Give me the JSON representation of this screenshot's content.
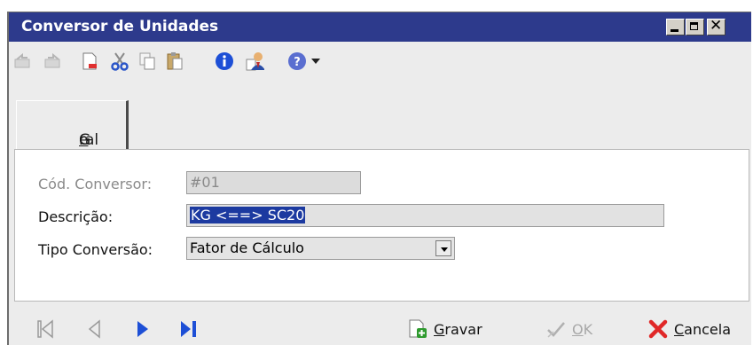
{
  "window": {
    "title": "Conversor de Unidades",
    "controls": {
      "minimize": "minimize",
      "maximize": "maximize",
      "close": "close"
    }
  },
  "toolbar": {
    "items": [
      {
        "icon": "undo-icon",
        "enabled": false
      },
      {
        "icon": "redo-icon",
        "enabled": false
      },
      {
        "icon": "new-document-icon",
        "enabled": true
      },
      {
        "icon": "cut-icon",
        "enabled": true
      },
      {
        "icon": "copy-icon",
        "enabled": true
      },
      {
        "icon": "paste-icon",
        "enabled": true
      },
      {
        "icon": "info-icon",
        "enabled": true
      },
      {
        "icon": "user-document-icon",
        "enabled": true
      },
      {
        "icon": "help-icon",
        "enabled": true
      }
    ]
  },
  "tabs": [
    {
      "label_pre": "G",
      "label_u": "e",
      "label_post": "ral",
      "selected": true
    }
  ],
  "form": {
    "codigo": {
      "label": "Cód. Conversor:",
      "value": "#01",
      "readonly": true
    },
    "descricao": {
      "label": "Descrição:",
      "value": "KG <==> SC20",
      "selected": true
    },
    "tipo": {
      "label": "Tipo Conversão:",
      "value": "Fator de Cálculo"
    }
  },
  "footer": {
    "nav": [
      "first-record-icon",
      "previous-record-icon",
      "next-record-icon",
      "last-record-icon"
    ],
    "gravar": {
      "u": "G",
      "rest": "ravar"
    },
    "ok": {
      "u": "O",
      "rest": "K",
      "enabled": false
    },
    "cancela": {
      "u": "C",
      "rest": "ancela"
    }
  },
  "colors": {
    "titlebar": "#2d3a8c",
    "selection": "#1c3aa0",
    "nav_active": "#1d4fd6",
    "nav_disabled": "#a0a0a0"
  }
}
